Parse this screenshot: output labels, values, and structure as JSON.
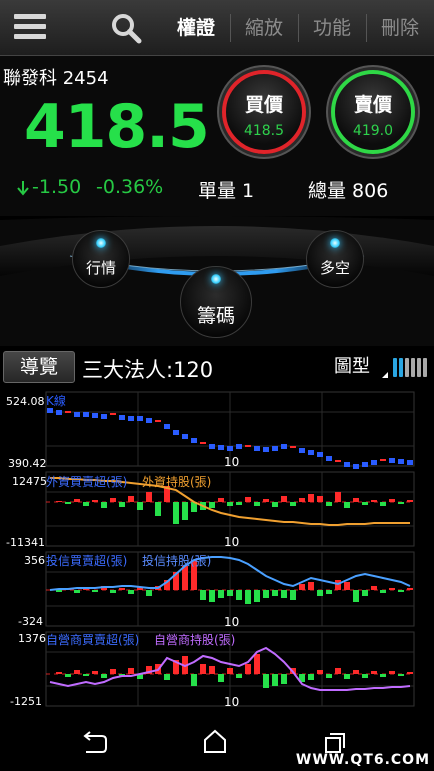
{
  "topbar": {
    "tabs": [
      "權證",
      "縮放",
      "功能",
      "刪除"
    ]
  },
  "stock": {
    "name": "聯發科 2454",
    "price": "418.5",
    "change": "-1.50",
    "change_pct": "-0.36%",
    "unit_volume": "單量 1",
    "total_volume": "總量 806"
  },
  "buy": {
    "label": "買價",
    "value": "418.5"
  },
  "sell": {
    "label": "賣價",
    "value": "419.0"
  },
  "nav": {
    "left": "行情",
    "center": "籌碼",
    "right": "多空"
  },
  "toolbar": {
    "guide": "導覽",
    "institutional": "三大法人:120",
    "chart_type": "圖型"
  },
  "colors": {
    "up": "#ff2a2a",
    "down": "#26e04a",
    "blue_series": "#2a5cff",
    "accent": "#2aa6e2"
  },
  "chart_data": [
    {
      "type": "line",
      "title": "K線",
      "ylim": [
        390.42,
        524.08
      ],
      "tick_labels": [
        "524.08",
        "390.42"
      ],
      "x_tick": "10"
    },
    {
      "type": "bar",
      "title": "外資買賣超(張)",
      "series": [
        {
          "name": "外資買賣超(張)",
          "values": []
        },
        {
          "name": "外資持股(張)",
          "values": []
        }
      ],
      "ylim": [
        -11341,
        12475
      ],
      "tick_labels": [
        "12475",
        "-11341"
      ],
      "x_tick": "10"
    },
    {
      "type": "bar",
      "title": "投信買賣超(張)",
      "series": [
        {
          "name": "投信買賣超(張)",
          "values": []
        },
        {
          "name": "投信持股(張)",
          "values": []
        }
      ],
      "ylim": [
        -324,
        356
      ],
      "tick_labels": [
        "356",
        "-324"
      ],
      "x_tick": "10"
    },
    {
      "type": "bar",
      "title": "自營商買賣超(張)",
      "series": [
        {
          "name": "自營商買賣超(張)",
          "values": []
        },
        {
          "name": "自營商持股(張)",
          "values": []
        }
      ],
      "ylim": [
        -1251,
        1376
      ],
      "tick_labels": [
        "1376",
        "-1251"
      ],
      "x_tick": "10"
    }
  ],
  "watermark": "WWW.QT6.COM"
}
